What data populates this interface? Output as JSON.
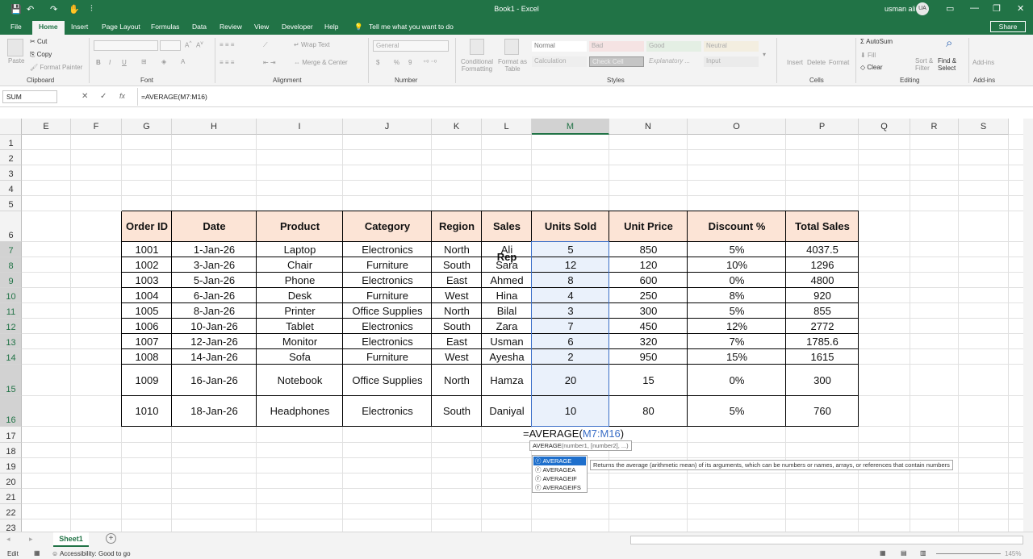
{
  "title_bar": {
    "doc_title": "Book1 - Excel",
    "user_name": "usman ali",
    "user_initials": "UA",
    "qa_save": "💾",
    "qa_undo": "↶",
    "qa_redo": "↷",
    "qa_touch": "✋",
    "qa_more": "⫶",
    "win_opts": "▭",
    "win_min": "—",
    "win_max": "❐",
    "win_close": "✕"
  },
  "tabs": [
    "File",
    "Home",
    "Insert",
    "Page Layout",
    "Formulas",
    "Data",
    "Review",
    "View",
    "Developer",
    "Help"
  ],
  "tell_me": "Tell me what you want to do",
  "share": "Share",
  "ribbon": {
    "paste": "Paste",
    "cut": "Cut",
    "copy": "Copy",
    "format_painter": "Format Painter",
    "font_name": "",
    "font_size": "",
    "bold": "B",
    "italic": "I",
    "underline": "U",
    "wrap_text": "Wrap Text",
    "merge_center": "Merge & Center",
    "number_format": "General",
    "currency": "$",
    "percent": "%",
    "comma": "9",
    "conditional_formatting": "Conditional Formatting",
    "format_as_table": "Format as Table",
    "styles": [
      "Normal",
      "Bad",
      "Good",
      "Neutral",
      "Calculation",
      "Check Cell",
      "Explanatory ...",
      "Input"
    ],
    "insert": "Insert",
    "delete": "Delete",
    "format": "Format",
    "autosum": "AutoSum",
    "fill": "Fill",
    "clear": "Clear",
    "sort_filter": "Sort & Filter",
    "find_select": "Find & Select",
    "addins": "Add-ins",
    "group_labels": [
      "Clipboard",
      "Font",
      "Alignment",
      "Number",
      "Styles",
      "Cells",
      "Editing",
      "Add-ins"
    ]
  },
  "formula_bar": {
    "name_box": "SUM",
    "cancel": "✕",
    "enter": "✓",
    "fx": "fx",
    "formula": "=AVERAGE(M7:M16)"
  },
  "columns": [
    "E",
    "F",
    "G",
    "H",
    "I",
    "J",
    "K",
    "L",
    "M",
    "N",
    "O",
    "P",
    "Q",
    "R",
    "S"
  ],
  "rows": [
    "1",
    "2",
    "3",
    "4",
    "5",
    "6",
    "7",
    "8",
    "9",
    "10",
    "11",
    "12",
    "13",
    "14",
    "15",
    "16",
    "17",
    "18",
    "19",
    "20",
    "21",
    "22",
    "23"
  ],
  "table": {
    "headers": [
      "Order ID",
      "Date",
      "Product",
      "Category",
      "Region",
      "Sales Rep",
      "Units Sold",
      "Unit Price",
      "Discount %",
      "Total Sales"
    ],
    "rows": [
      [
        "1001",
        "1-Jan-26",
        "Laptop",
        "Electronics",
        "North",
        "Ali",
        "5",
        "850",
        "5%",
        "4037.5"
      ],
      [
        "1002",
        "3-Jan-26",
        "Chair",
        "Furniture",
        "South",
        "Sara",
        "12",
        "120",
        "10%",
        "1296"
      ],
      [
        "1003",
        "5-Jan-26",
        "Phone",
        "Electronics",
        "East",
        "Ahmed",
        "8",
        "600",
        "0%",
        "4800"
      ],
      [
        "1004",
        "6-Jan-26",
        "Desk",
        "Furniture",
        "West",
        "Hina",
        "4",
        "250",
        "8%",
        "920"
      ],
      [
        "1005",
        "8-Jan-26",
        "Printer",
        "Office Supplies",
        "North",
        "Bilal",
        "3",
        "300",
        "5%",
        "855"
      ],
      [
        "1006",
        "10-Jan-26",
        "Tablet",
        "Electronics",
        "South",
        "Zara",
        "7",
        "450",
        "12%",
        "2772"
      ],
      [
        "1007",
        "12-Jan-26",
        "Monitor",
        "Electronics",
        "East",
        "Usman",
        "6",
        "320",
        "7%",
        "1785.6"
      ],
      [
        "1008",
        "14-Jan-26",
        "Sofa",
        "Furniture",
        "West",
        "Ayesha",
        "2",
        "950",
        "15%",
        "1615"
      ],
      [
        "1009",
        "16-Jan-26",
        "Notebook",
        "Office Supplies",
        "North",
        "Hamza",
        "20",
        "15",
        "0%",
        "300"
      ],
      [
        "1010",
        "18-Jan-26",
        "Headphones",
        "Electronics",
        "South",
        "Daniyal",
        "10",
        "80",
        "5%",
        "760"
      ]
    ]
  },
  "edit_cell": {
    "prefix": "=AVERAGE(",
    "ref": "M7:M16",
    "suffix": ")"
  },
  "autocomplete": {
    "signature_fn": "AVERAGE",
    "signature_args": "(number1, [number2], ...)",
    "items": [
      "AVERAGE",
      "AVERAGEA",
      "AVERAGEIF",
      "AVERAGEIFS"
    ],
    "tooltip": "Returns the average (arithmetic mean) of its arguments, which can be numbers or names, arrays, or references that contain numbers"
  },
  "sheet_tab": "Sheet1",
  "add_sheet": "+",
  "status": {
    "mode": "Edit",
    "accessibility": "Accessibility: Good to go",
    "zoom": "145%"
  },
  "colors": {
    "excel_green": "#217346",
    "header_fill": "#fce4d6",
    "selection_fill": "#eaf1fb",
    "ref_blue": "#3a6ec7"
  }
}
